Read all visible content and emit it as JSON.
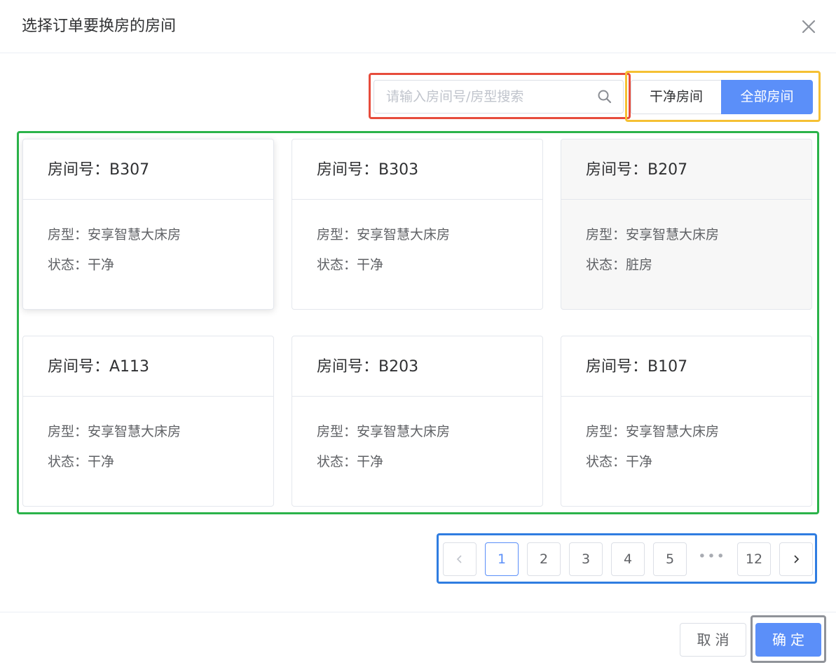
{
  "dialog": {
    "title": "选择订单要换房的房间",
    "close_icon": "close-icon"
  },
  "search": {
    "placeholder": "请输入房间号/房型搜索",
    "value": "",
    "icon": "search-icon"
  },
  "filter": {
    "options": [
      "干净房间",
      "全部房间"
    ],
    "selected": "全部房间"
  },
  "rooms": [
    {
      "room_label": "房间号：B307",
      "type_label": "房型：安享智慧大床房",
      "status_label": "状态：干净"
    },
    {
      "room_label": "房间号：B303",
      "type_label": "房型：安享智慧大床房",
      "status_label": "状态：干净"
    },
    {
      "room_label": "房间号：B207",
      "type_label": "房型：安享智慧大床房",
      "status_label": "状态：脏房"
    },
    {
      "room_label": "房间号：A113",
      "type_label": "房型：安享智慧大床房",
      "status_label": "状态：干净"
    },
    {
      "room_label": "房间号：B203",
      "type_label": "房型：安享智慧大床房",
      "status_label": "状态：干净"
    },
    {
      "room_label": "房间号：B107",
      "type_label": "房型：安享智慧大床房",
      "status_label": "状态：干净"
    }
  ],
  "pagination": {
    "prev_icon": "chevron-left-icon",
    "next_icon": "chevron-right-icon",
    "pages": [
      "1",
      "2",
      "3",
      "4",
      "5",
      "12"
    ],
    "ellipsis": "•••",
    "current": "1"
  },
  "footer": {
    "cancel_label": "取消",
    "confirm_label": "确定"
  },
  "colors": {
    "primary": "#5b8ff9",
    "annotation_search": "#e74c3c",
    "annotation_filter": "#f5c033",
    "annotation_grid": "#2bb34a",
    "annotation_pager": "#2f7de1",
    "annotation_confirm": "#909399"
  }
}
